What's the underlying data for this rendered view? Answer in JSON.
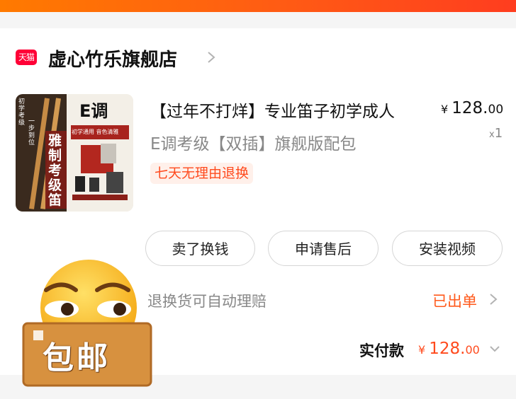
{
  "shop": {
    "badge_text": "天猫",
    "name": "虚心竹乐旗舰店",
    "chevron_icon": "chevron-right-icon"
  },
  "product": {
    "title_line1": "【过年不打烊】专业笛子初学成人",
    "title_line2": "E调考级【双插】旗舰版配包",
    "price_symbol": "¥",
    "price_int": "128.",
    "price_dec": "00",
    "qty_prefix": "x",
    "qty": "1",
    "return_tag": "七天无理由退换",
    "image": {
      "key_label": "E调",
      "side_label_1": "初学考级",
      "side_label_2": "一步到位",
      "banner": "雅制考级笛",
      "subtitle": "初学通用 音色清雅"
    }
  },
  "actions": {
    "sell": "卖了换钱",
    "after_sale": "申请售后",
    "install_video": "安装视频"
  },
  "claim_text": "退换货可自动理赔",
  "status_text": "已出单",
  "payment": {
    "label": "实付款",
    "symbol": "¥",
    "int": "128.",
    "dec": "00"
  },
  "sticker": {
    "text": "包邮",
    "icon": "grinning-emoji-icon"
  },
  "colors": {
    "accent": "#ff4a1d",
    "tmall_red": "#ff0036",
    "top_bar": "#ff6a0a"
  }
}
